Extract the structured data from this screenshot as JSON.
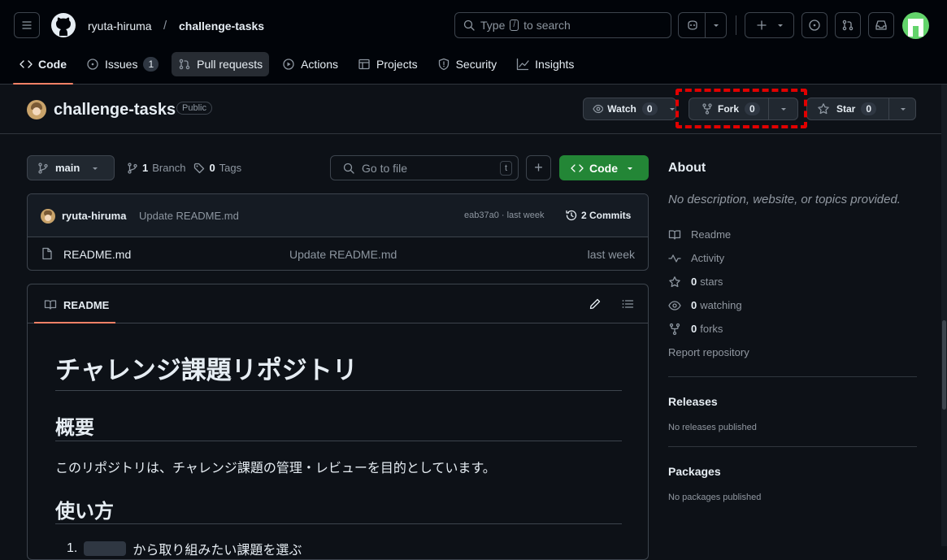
{
  "header": {
    "owner": "ryuta-hiruma",
    "separator": "/",
    "repo": "challenge-tasks",
    "search_pre": "Type",
    "search_key": "/",
    "search_post": "to search"
  },
  "nav": {
    "tabs": [
      {
        "label": "Code"
      },
      {
        "label": "Issues",
        "count": "1"
      },
      {
        "label": "Pull requests"
      },
      {
        "label": "Actions"
      },
      {
        "label": "Projects"
      },
      {
        "label": "Security"
      },
      {
        "label": "Insights"
      }
    ]
  },
  "repo": {
    "name": "challenge-tasks",
    "visibility": "Public",
    "watch_label": "Watch",
    "watch_count": "0",
    "fork_label": "Fork",
    "fork_count": "0",
    "star_label": "Star",
    "star_count": "0"
  },
  "toolbar": {
    "branch": "main",
    "branch_count": "1",
    "branch_label": "Branch",
    "tag_count": "0",
    "tag_label": "Tags",
    "goto_placeholder": "Go to file",
    "goto_key": "t",
    "add": "+",
    "code_label": "Code"
  },
  "commit": {
    "author": "ryuta-hiruma",
    "message": "Update README.md",
    "hash": "eab37a0 · last week",
    "commits": "2 Commits"
  },
  "files": [
    {
      "name": "README.md",
      "message": "Update README.md",
      "age": "last week"
    }
  ],
  "readme": {
    "tab": "README",
    "h1": "チャレンジ課題リポジトリ",
    "h2a": "概要",
    "p1": "このリポジトリは、チャレンジ課題の管理・レビューを目的としています。",
    "h2b": "使い方",
    "li1": "から取り組みたい課題を選ぶ"
  },
  "about": {
    "title": "About",
    "desc": "No description, website, or topics provided.",
    "readme": "Readme",
    "activity": "Activity",
    "stars_n": "0",
    "stars": "stars",
    "watching_n": "0",
    "watching": "watching",
    "forks_n": "0",
    "forks": "forks",
    "report": "Report repository"
  },
  "releases": {
    "title": "Releases",
    "text": "No releases published"
  },
  "packages": {
    "title": "Packages",
    "text": "No packages published"
  },
  "colors": {
    "accent_green": "#238636",
    "tab_underline": "#f78166",
    "annotation_red": "#e10000",
    "link": "#4493f8"
  }
}
